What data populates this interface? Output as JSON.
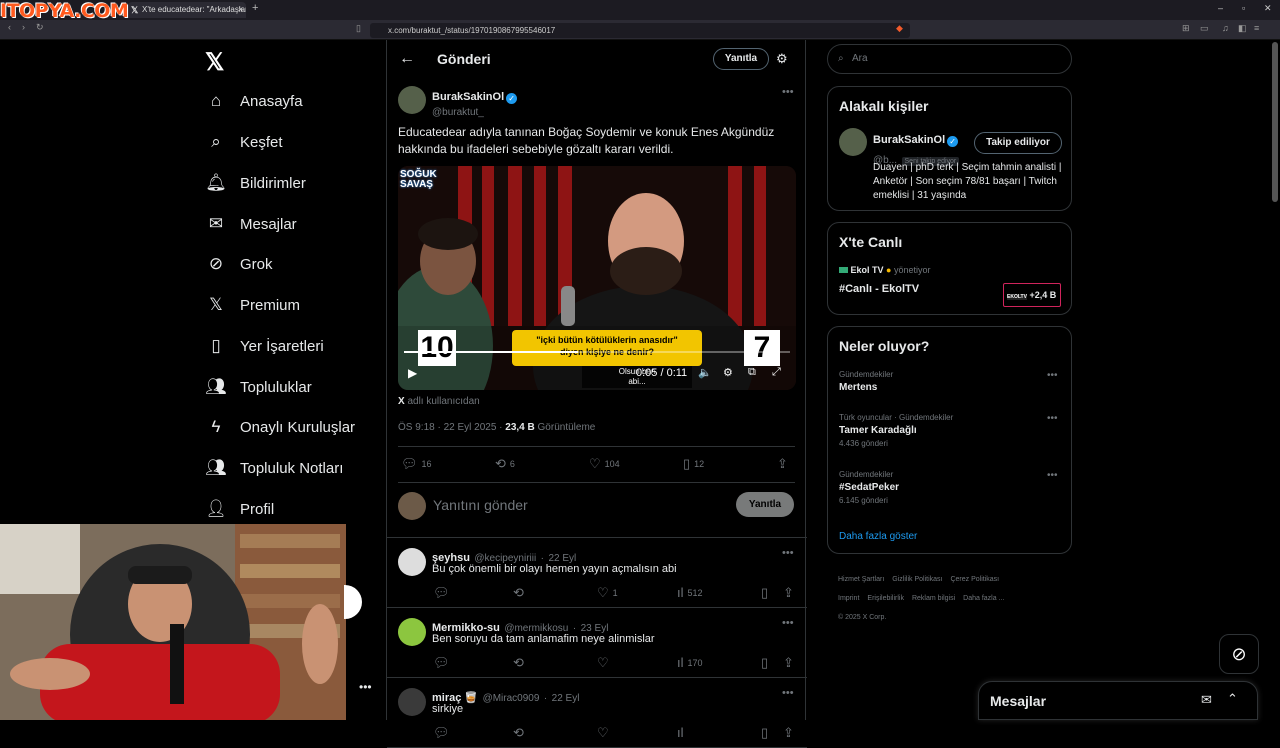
{
  "browser": {
    "logo_text": "ITOPYA.COM",
    "tab_title": "X'te educatedear: \"Arkadaşlar, Geçtiğ",
    "url": "x.com/buraktut_/status/1970190867995546017"
  },
  "nav": {
    "items": [
      {
        "label": "Anasayfa",
        "icon": "home-icon"
      },
      {
        "label": "Keşfet",
        "icon": "search-icon"
      },
      {
        "label": "Bildirimler",
        "icon": "bell-icon"
      },
      {
        "label": "Mesajlar",
        "icon": "mail-icon"
      },
      {
        "label": "Grok",
        "icon": "grok-icon"
      },
      {
        "label": "Premium",
        "icon": "x-icon"
      },
      {
        "label": "Yer İşaretleri",
        "icon": "bookmark-icon"
      },
      {
        "label": "Topluluklar",
        "icon": "people-icon"
      },
      {
        "label": "Onaylı Kuruluşlar",
        "icon": "lightning-icon"
      },
      {
        "label": "Topluluk Notları",
        "icon": "community-notes-icon"
      },
      {
        "label": "Profil",
        "icon": "person-icon"
      }
    ]
  },
  "header": {
    "title": "Gönderi",
    "reply_button": "Yanıtla"
  },
  "post": {
    "author_name": "BurakSakinOl",
    "author_handle": "@buraktut_",
    "text": "Educatedear adıyla tanınan Boğaç Soydemir ve konuk Enes Akgündüz hakkında bu ifadeleri sebebiyle gözaltı kararı verildi.",
    "video": {
      "brand": "SOĞUK SAVAŞ",
      "score_left": "10",
      "score_right": "7",
      "caption_line1": "\"içki bütün kötülüklerin anasıdır\"",
      "caption_line2": "diyen kişiye ne denir?",
      "subtitle_line1": "Olsun ben",
      "subtitle_line2": "abi...",
      "time": "0:05 / 0:11",
      "progress": 0.45
    },
    "source_prefix": "X",
    "source_suffix": "adlı kullanıcıdan",
    "timestamp": "ÖS 9:18 · 22 Eyl 2025 · ",
    "views_value": "23,4 B",
    "views_label": "Görüntüleme",
    "replies": "16",
    "reposts": "6",
    "likes": "104",
    "bookmarks": "12"
  },
  "composer": {
    "placeholder": "Yanıtını gönder",
    "button": "Yanıtla"
  },
  "replies": [
    {
      "name": "şeyhsu",
      "handle": "@kecipeyniriii",
      "date": "22 Eyl",
      "text": "Bu çok önemli bir olayı hemen yayın açmalısın abi",
      "likes": "1",
      "views": "512"
    },
    {
      "name": "Mermikko-su",
      "handle": "@mermikkosu",
      "date": "23 Eyl",
      "text": "Ben soruyu da tam anlamafim neye alinmislar",
      "likes": "",
      "views": "170"
    },
    {
      "name": "miraç 🥃",
      "handle": "@Mirac0909",
      "date": "22 Eyl",
      "text": "sirkiye",
      "likes": "",
      "views": ""
    }
  ],
  "search": {
    "placeholder": "Ara"
  },
  "related": {
    "title": "Alakalı kişiler",
    "name": "BurakSakinOl",
    "handle": "@b...",
    "follows_you": "Seni takip ediyor",
    "follow_button": "Takip ediliyor",
    "bio": "Duayen | phD terk | Seçim tahmin analisti | Anketör | Son seçim 78/81 başarı | Twitch emeklisi | 31 yaşında"
  },
  "live": {
    "title": "X'te Canlı",
    "host": "Ekol TV",
    "host_suffix": "yönetiyor",
    "stream_title": "#Canlı - EkolTV",
    "badge_brand": "EKOLTV",
    "viewers": "+2,4 B"
  },
  "trends": {
    "title": "Neler oluyor?",
    "items": [
      {
        "meta": "Gündemdekiler",
        "name": "Mertens",
        "count": ""
      },
      {
        "meta": "Türk oyuncular · Gündemdekiler",
        "name": "Tamer Karadağlı",
        "count": "4.436 gönderi"
      },
      {
        "meta": "Gündemdekiler",
        "name": "#SedatPeker",
        "count": "6.145 gönderi"
      }
    ],
    "show_more": "Daha fazla göster"
  },
  "footer": {
    "links": [
      "Hizmet Şartları",
      "Gizlilik Politikası",
      "Çerez Politikası",
      "Imprint",
      "Erişilebilirlik",
      "Reklam bilgisi",
      "Daha fazla ..."
    ],
    "copyright": "© 2025 X Corp."
  },
  "messages": {
    "title": "Mesajlar"
  },
  "colors": {
    "accent": "#1d9bf0",
    "background": "#000000",
    "border": "#2f3336",
    "muted": "#71767b"
  }
}
